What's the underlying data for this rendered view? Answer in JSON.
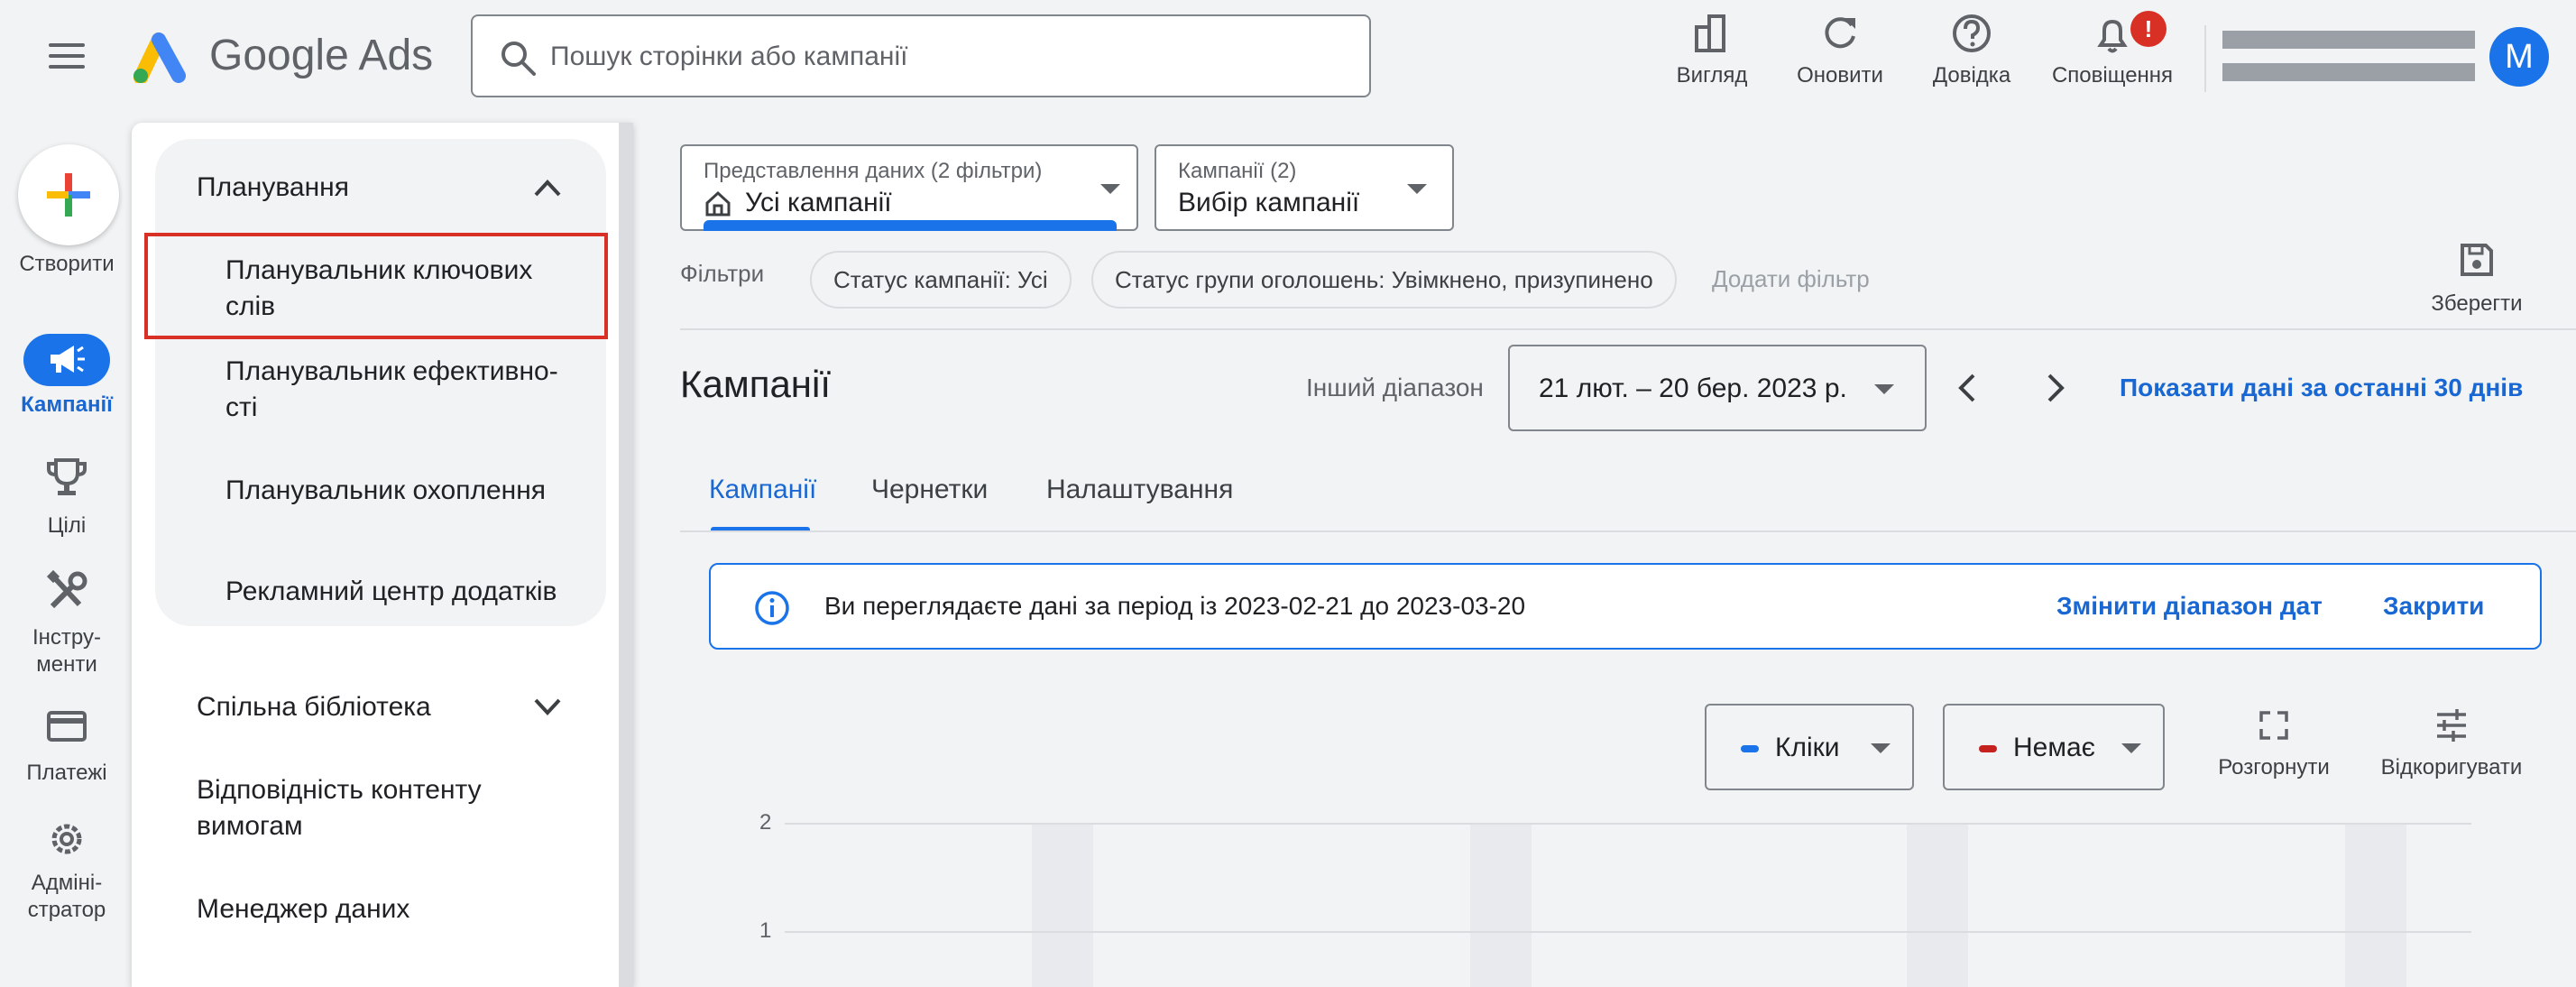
{
  "app": {
    "title": "Google Ads"
  },
  "search": {
    "placeholder": "Пошук сторінки або кампанії"
  },
  "top_actions": {
    "view": "Вигляд",
    "refresh": "Оновити",
    "help": "Довідка",
    "notifications": "Сповіщення",
    "notification_badge": "!"
  },
  "account": {
    "avatar_letter": "M"
  },
  "rail": {
    "create": "Створити",
    "campaigns": "Кампанії",
    "goals": "Цілі",
    "tools_line1": "Інстру-",
    "tools_line2": "менти",
    "billing": "Платежі",
    "admin_line1": "Адміні-",
    "admin_line2": "стратор"
  },
  "nav_panel": {
    "planning": "Планування",
    "keyword_planner_line1": "Планувальник ключових",
    "keyword_planner_line2": "слів",
    "performance_planner_line1": "Планувальник ефективно-",
    "performance_planner_line2": "сті",
    "reach_planner": "Планувальник охоплення",
    "app_ad_hub": "Рекламний центр додатків",
    "shared_library": "Спільна бібліотека",
    "content_suitability_line1": "Відповідність контенту",
    "content_suitability_line2": "вимогам",
    "data_manager": "Менеджер даних"
  },
  "view_selector": {
    "sub": "Представлення даних (2 фільтри)",
    "value": "Усі кампанії"
  },
  "campaign_selector": {
    "sub": "Кампанії (2)",
    "value": "Вибір кампанії"
  },
  "filters": {
    "label": "Фільтри",
    "chip_status": "Статус кампанії: Усі",
    "chip_adgroup": "Статус групи оголошень: Увімкнено, призупинено",
    "add": "Додати фільтр",
    "save": "Зберегти"
  },
  "page": {
    "title": "Кампанії",
    "range_label": "Інший діапазон",
    "date_range": "21 лют. – 20 бер. 2023 р.",
    "show_last_30": "Показати дані за останні 30 днів"
  },
  "tabs": [
    "Кампанії",
    "Чернетки",
    "Налаштування"
  ],
  "info_bar": {
    "message": "Ви переглядаєте дані за період із 2023-02-21 до 2023-03-20",
    "change_range": "Змінити діапазон дат",
    "close": "Закрити"
  },
  "chart_controls": {
    "metric1": "Кліки",
    "metric2": "Немає",
    "expand": "Розгорнути",
    "adjust": "Відкоригувати"
  },
  "chart_data": {
    "type": "bar",
    "y_ticks": [
      "2",
      "1"
    ],
    "ylim": [
      0,
      2
    ],
    "series": [
      {
        "name": "Кліки",
        "color": "#1a73e8"
      }
    ]
  },
  "colors": {
    "accent": "#1a73e8",
    "link": "#1967d2",
    "alert": "#d93025",
    "metric2": "#c5221f"
  }
}
